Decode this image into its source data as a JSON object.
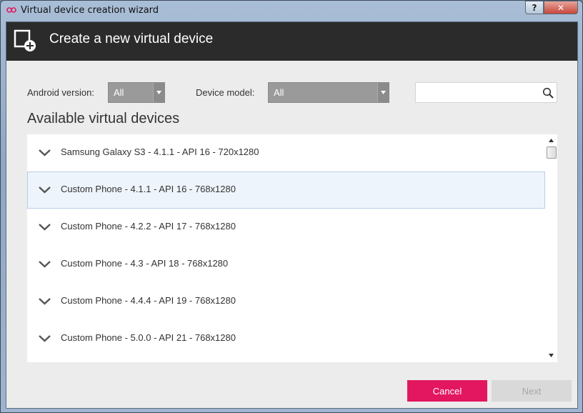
{
  "window": {
    "title": "Virtual device creation wizard",
    "help_label": "?",
    "close_label": "✕"
  },
  "header": {
    "title": "Create a new virtual device",
    "icon": "new-device-icon"
  },
  "filters": {
    "android_version": {
      "label": "Android version:",
      "value": "All"
    },
    "device_model": {
      "label": "Device model:",
      "value": "All"
    },
    "search": {
      "placeholder": "",
      "value": "",
      "icon": "search-icon"
    }
  },
  "devices": {
    "title": "Available virtual devices",
    "items": [
      {
        "label": "Samsung Galaxy S3 - 4.1.1 - API 16 - 720x1280",
        "selected": false
      },
      {
        "label": "Custom Phone - 4.1.1 - API 16 - 768x1280",
        "selected": true
      },
      {
        "label": "Custom Phone - 4.2.2 - API 17 - 768x1280",
        "selected": false
      },
      {
        "label": "Custom Phone - 4.3 - API 18 - 768x1280",
        "selected": false
      },
      {
        "label": "Custom Phone - 4.4.4 - API 19 - 768x1280",
        "selected": false
      },
      {
        "label": "Custom Phone - 5.0.0 - API 21 - 768x1280",
        "selected": false
      }
    ]
  },
  "footer": {
    "cancel_label": "Cancel",
    "next_label": "Next"
  },
  "colors": {
    "header_bg": "#2b2b2b",
    "accent": "#e3175f",
    "disabled_button": "#d9d9d9",
    "selected_row": "#eef4fb"
  }
}
